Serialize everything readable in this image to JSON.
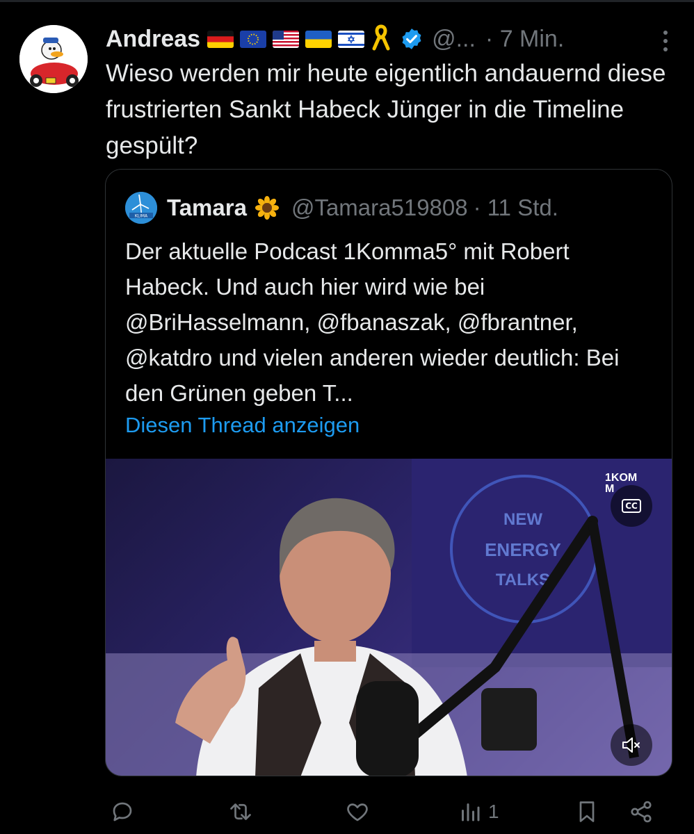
{
  "post": {
    "author_name": "Andreas",
    "handle": "@...",
    "time": "· 7 Min.",
    "text": "Wieso werden mir heute eigentlich andauernd diese frustrierten Sankt Habeck Jünger in die Timeline gespült?",
    "flags": [
      "germany-flag",
      "eu-flag",
      "usa-flag",
      "ukraine-flag",
      "israel-flag",
      "yellow-ribbon"
    ]
  },
  "quote": {
    "author_name": "Tamara",
    "emoji": "sunflower",
    "handle": "@Tamara519808",
    "time": "· 11 Std.",
    "text": "Der aktuelle Podcast 1Komma5° mit Robert Habeck. Und auch hier wird wie bei @BriHasselmann, @fbanaszak, @fbrantner, @katdro und vielen anderen wieder deutlich: Bei den Grünen geben T...",
    "show_thread": "Diesen Thread anzeigen",
    "avatar_text": "KLIMA",
    "media": {
      "corner_logo": "1KOM\nM",
      "sign_text": "NEW\nENERGY\nTALKS",
      "cc_label": "CC"
    }
  },
  "actions": {
    "reply": "",
    "repost": "",
    "like": "",
    "views": "1",
    "bookmark": "",
    "share": ""
  },
  "colors": {
    "background": "#000000",
    "text": "#e7e9ea",
    "muted": "#71767b",
    "link": "#1d9bf0",
    "border": "#2f3336",
    "verified": "#1d9bf0"
  }
}
